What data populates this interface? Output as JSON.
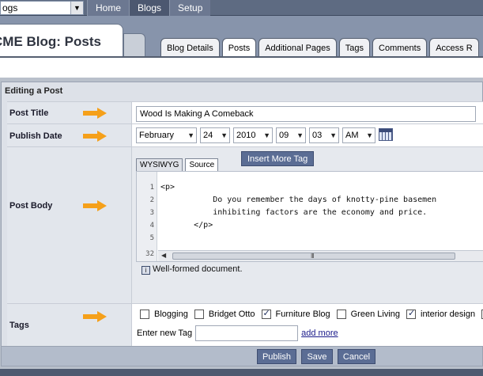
{
  "topbar": {
    "site_select_value": "ogs",
    "nav": [
      "Home",
      "Blogs",
      "Setup"
    ]
  },
  "header": {
    "page_title": "CME Blog: Posts",
    "tabs": [
      "Blog Details",
      "Posts",
      "Additional Pages",
      "Tags",
      "Comments",
      "Access R"
    ]
  },
  "panel": {
    "title": "Editing a Post",
    "post_title": {
      "label": "Post Title",
      "value": "Wood Is Making A Comeback"
    },
    "publish_date": {
      "label": "Publish Date",
      "month": "February",
      "day": "24",
      "year": "2010",
      "hour": "09",
      "minute": "03",
      "ampm": "AM"
    },
    "post_body": {
      "label": "Post Body",
      "tabs": [
        "WYSIWYG",
        "Source"
      ],
      "insert_more_tag": "Insert More Tag",
      "line_numbers": [
        "1",
        "2",
        "3",
        "4",
        "5",
        "32"
      ],
      "lines": [
        "<p>",
        "           Do you remember the days of knotty-pine basemen",
        "           inhibiting factors are the economy and price.  ",
        "       </p>"
      ],
      "scroll_grip": "III",
      "status": "Well-formed document.",
      "status_icon": "i"
    },
    "tags": {
      "label": "Tags",
      "items": [
        {
          "name": "Blogging",
          "checked": false
        },
        {
          "name": "Bridget Otto",
          "checked": false
        },
        {
          "name": "Furniture Blog",
          "checked": true
        },
        {
          "name": "Green Living",
          "checked": false
        },
        {
          "name": "interior design",
          "checked": true
        }
      ],
      "truncated_next": "i",
      "new_tag_label": "Enter new Tag",
      "add_more": "add more"
    },
    "buttons": {
      "publish": "Publish",
      "save": "Save",
      "cancel": "Cancel"
    }
  },
  "colors": {
    "pointer_arrow": "#f5a01a",
    "button": "#5b6d94",
    "nav_bar": "#5e6b82"
  }
}
